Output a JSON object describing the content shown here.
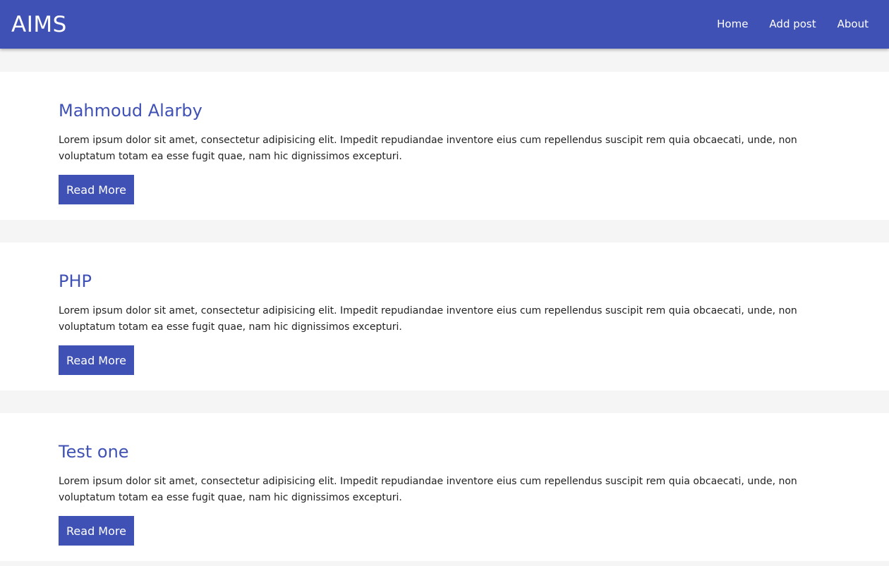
{
  "header": {
    "brand": "AIMS",
    "nav": [
      {
        "label": "Home"
      },
      {
        "label": "Add post"
      },
      {
        "label": "About"
      }
    ]
  },
  "posts": [
    {
      "title": "Mahmoud Alarby",
      "body": "Lorem ipsum dolor sit amet, consectetur adipisicing elit. Impedit repudiandae inventore eius cum repellendus suscipit rem quia obcaecati, unde, non voluptatum totam ea esse fugit quae, nam hic dignissimos excepturi.",
      "button": "Read More"
    },
    {
      "title": "PHP",
      "body": "Lorem ipsum dolor sit amet, consectetur adipisicing elit. Impedit repudiandae inventore eius cum repellendus suscipit rem quia obcaecati, unde, non voluptatum totam ea esse fugit quae, nam hic dignissimos excepturi.",
      "button": "Read More"
    },
    {
      "title": "Test one",
      "body": "Lorem ipsum dolor sit amet, consectetur adipisicing elit. Impedit repudiandae inventore eius cum repellendus suscipit rem quia obcaecati, unde, non voluptatum totam ea esse fugit quae, nam hic dignissimos excepturi.",
      "button": "Read More"
    }
  ],
  "colors": {
    "primary": "#3f51b5",
    "background": "#f5f5f5",
    "card": "#ffffff",
    "text": "#222222"
  }
}
